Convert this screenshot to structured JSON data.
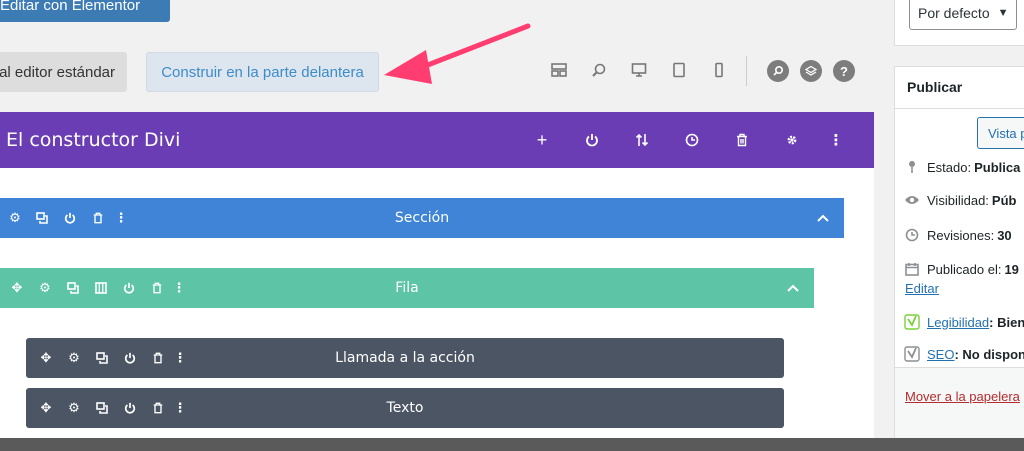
{
  "top_buttons": {
    "elementor": "Editar con Elementor",
    "standard_editor": "al editor estándar",
    "frontend": "Construir en la parte delantera"
  },
  "toolbar_icons": [
    "layout-icon",
    "zoom-icon",
    "desktop-icon",
    "tablet-icon",
    "phone-icon",
    "search-icon",
    "layers-icon",
    "help-icon"
  ],
  "divi": {
    "title": "El constructor Divi",
    "header_icons": [
      "plus-icon",
      "power-icon",
      "sort-icon",
      "history-icon",
      "trash-icon",
      "gear-icon",
      "more-icon"
    ],
    "section": "Sección",
    "row": "Fila",
    "modules": [
      "Llamada a la acción",
      "Texto"
    ],
    "colors": {
      "header": "#6b3db5",
      "section": "#3f84d6",
      "row": "#5ec4a6",
      "module": "#4b5563"
    }
  },
  "sidebar": {
    "select_value": "Por defecto",
    "publish": {
      "title": "Publicar",
      "preview": "Vista p",
      "status_label": "Estado:",
      "status_value": "Publica",
      "visibility_label": "Visibilidad:",
      "visibility_value": "Púb",
      "revisions_label": "Revisiones:",
      "revisions_value": "30",
      "published_label": "Publicado el:",
      "published_value": "19",
      "edit": "Editar",
      "readability_link": "Legibilidad",
      "readability_value": ": Bien",
      "seo_link": "SEO",
      "seo_value": ": No dispon",
      "trash": "Mover a la papelera"
    }
  },
  "accent": "#ff3d71"
}
